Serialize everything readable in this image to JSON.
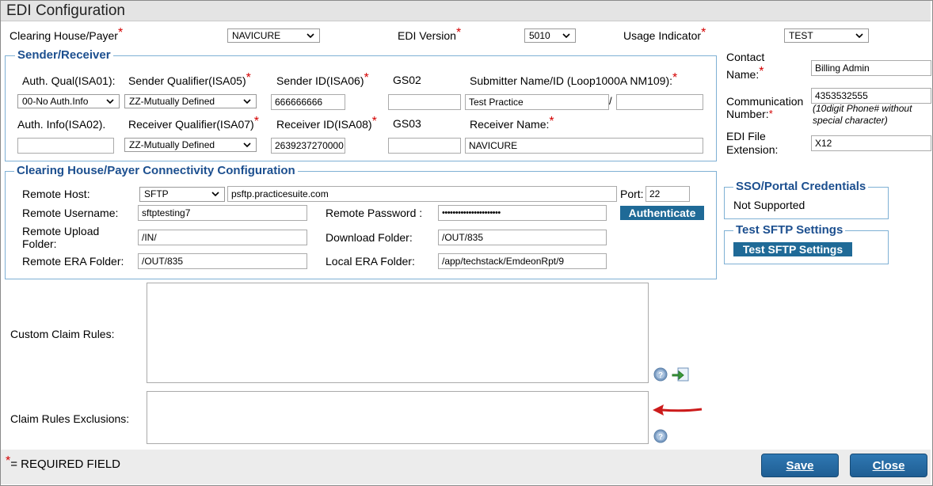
{
  "window": {
    "title": "EDI Configuration"
  },
  "header": {
    "clearing_label": "Clearing House/Payer",
    "clearing_value": "NAVICURE",
    "edi_version_label": "EDI Version",
    "edi_version_value": "5010",
    "usage_label": "Usage Indicator",
    "usage_value": "TEST"
  },
  "sender_receiver": {
    "legend": "Sender/Receiver",
    "auth_qual_label": "Auth. Qual(ISA01):",
    "auth_qual_value": "00-No Auth.Info",
    "sender_qual_label": "Sender Qualifier(ISA05)",
    "sender_qual_value": "ZZ-Mutually Defined",
    "sender_id_label": "Sender ID(ISA06)",
    "sender_id_value": "666666666",
    "gs02_label": "GS02",
    "gs02_value": "",
    "submitter_label": "Submitter Name/ID (Loop1000A NM109):",
    "submitter_name_value": "Test Practice",
    "submitter_sep": "/",
    "submitter_id_value": "",
    "auth_info_label": "Auth. Info(ISA02).",
    "auth_info_value": "",
    "receiver_qual_label": "Receiver Qualifier(ISA07)",
    "receiver_qual_value": "ZZ-Mutually Defined",
    "receiver_id_label": "Receiver ID(ISA08)",
    "receiver_id_value": "2639237270000",
    "gs03_label": "GS03",
    "gs03_value": "",
    "receiver_name_label": "Receiver Name:",
    "receiver_name_value": "NAVICURE"
  },
  "contact": {
    "contact_label_1": "Contact",
    "contact_label_2": "Name:",
    "contact_value": "Billing Admin",
    "comm_label_1": "Communication",
    "comm_label_2": "Number:",
    "comm_value": "4353532555",
    "comm_hint_1": "(10digit Phone# without",
    "comm_hint_2": "special character)",
    "ext_label_1": "EDI File",
    "ext_label_2": "Extension:",
    "ext_value": "X12"
  },
  "connectivity": {
    "legend": "Clearing House/Payer Connectivity Configuration",
    "remote_host_label": "Remote Host:",
    "protocol_value": "SFTP",
    "host_value": "psftp.practicesuite.com",
    "port_label": "Port:",
    "port_value": "22",
    "username_label": "Remote Username:",
    "username_value": "sftptesting7",
    "password_label": "Remote Password :",
    "password_value": "••••••••••••••••••••••",
    "authenticate_label": "Authenticate",
    "upload_label_1": "Remote Upload",
    "upload_label_2": "Folder:",
    "upload_value": "/IN/",
    "download_label": "Download Folder:",
    "download_value": "/OUT/835",
    "era_label": "Remote ERA Folder:",
    "era_value": "/OUT/835",
    "local_era_label": "Local ERA Folder:",
    "local_era_value": "/app/techstack/EmdeonRpt/9"
  },
  "sso": {
    "legend": "SSO/Portal Credentials",
    "status": "Not Supported"
  },
  "sftp_test": {
    "legend": "Test SFTP Settings",
    "button_label": "Test SFTP Settings"
  },
  "rules": {
    "custom_label": "Custom Claim Rules:",
    "custom_value": "",
    "exclusions_label": "Claim Rules Exclusions:",
    "exclusions_value": ""
  },
  "footer": {
    "required_star": "*",
    "required_note": "= REQUIRED FIELD",
    "save_label": "Save",
    "close_label": "Close"
  },
  "required_marker": "*",
  "colors": {
    "accent": "#1f6a97",
    "legend": "#1c4f8f",
    "required": "#d40000",
    "arrow": "#cc1b1b"
  },
  "icons": [
    "chevron-down-icon",
    "help-icon",
    "import-arrow-icon",
    "red-arrow-icon"
  ]
}
